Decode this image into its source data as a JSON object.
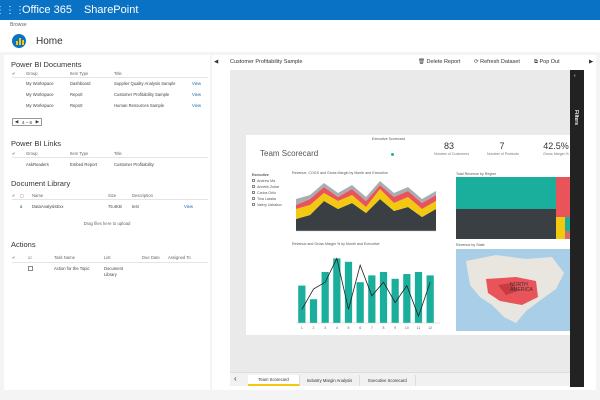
{
  "suitebar": {
    "app": "Office 365",
    "site": "SharePoint"
  },
  "subbar": {
    "text": "Browse"
  },
  "page": {
    "title": "Home"
  },
  "powerbi_docs": {
    "title": "Power BI Documents",
    "headers": [
      "Group",
      "Item Type",
      "Title"
    ],
    "rows": [
      {
        "group": "My Workspace",
        "type": "Dashboard",
        "title": "Supplier Quality Analysis Sample",
        "action": "View"
      },
      {
        "group": "My Workspace",
        "type": "Report",
        "title": "Customer Profitability Sample",
        "action": "View"
      },
      {
        "group": "My Workspace",
        "type": "Report",
        "title": "Human Resources Sample",
        "action": "View"
      }
    ],
    "pager": {
      "prev": "◀",
      "text": "4 – 6",
      "next": "▶"
    }
  },
  "powerbi_links": {
    "title": "Power BI Links",
    "headers": [
      "Group",
      "Item Type",
      "Title"
    ],
    "rows": [
      {
        "group": "AskReaders",
        "type": "Embed Report",
        "title": "Customer Profitability"
      }
    ]
  },
  "doc_library": {
    "title": "Document Library",
    "headers": [
      "Name",
      "Size",
      "Description"
    ],
    "rows": [
      {
        "name": "DataAnalysisExx",
        "size": "76.4KB",
        "desc": "test",
        "action": "View"
      }
    ],
    "drag_text": "Drag files here to upload"
  },
  "actions": {
    "title": "Actions",
    "headers": [
      "Task Name",
      "List",
      "Due Date",
      "Assigned To"
    ],
    "rows": [
      {
        "task": "Action for the Topic",
        "list": "Document Library"
      }
    ]
  },
  "report": {
    "title": "Customer Profitability Sample",
    "delete": "Delete Report",
    "refresh": "Refresh Dataset",
    "popout": "Pop Out",
    "filters": "Filters",
    "scorecard_title": "Team Scorecard",
    "exec_label": "Executive Scorecard",
    "kpis": [
      {
        "value": "83",
        "label": "Number of Customers"
      },
      {
        "value": "7",
        "label": "Number of Products"
      },
      {
        "value": "42.5%",
        "label": "Gross Margin %"
      }
    ],
    "area_title": "Revenue, COGS and Gross Margin by Month and Executive",
    "legend_title": "Executive",
    "executives": [
      "Andrew Ma",
      "Annelie Zubar",
      "Carlos Grilo",
      "Tina Lassila",
      "Valery Ushakov"
    ],
    "combo_title": "Revenue and Gross Margin % by Month and Executive",
    "treemap_title": "Total Revenue by Region",
    "map_title": "Revenue by State",
    "map_label": "NORTH AMERICA",
    "tabs": [
      "Team Scorecard",
      "Industry Margin Analysis",
      "Executive Scorecard"
    ]
  },
  "colors": {
    "accent": "#0a72c5",
    "teal": "#1aaf9c",
    "dark": "#3a3f43",
    "yellow": "#f2c811",
    "red": "#e8545a"
  },
  "chart_data": {
    "type": "bar",
    "title": "Revenue and Gross Margin % by Month and Executive",
    "categories": [
      "1",
      "2",
      "3",
      "4",
      "5",
      "6",
      "7",
      "8",
      "9",
      "10",
      "11",
      "12"
    ],
    "series": [
      {
        "name": "Revenue",
        "values": [
          0.55,
          0.35,
          0.75,
          0.95,
          0.9,
          0.6,
          0.7,
          0.75,
          0.65,
          0.72,
          0.75,
          0.7
        ]
      },
      {
        "name": "Gross Margin %",
        "values": [
          0.2,
          0.5,
          0.6,
          0.95,
          0.2,
          0.85,
          0.4,
          0.6,
          0.3,
          0.55,
          0.1,
          0.6
        ]
      }
    ],
    "ylim": [
      0,
      1
    ]
  }
}
